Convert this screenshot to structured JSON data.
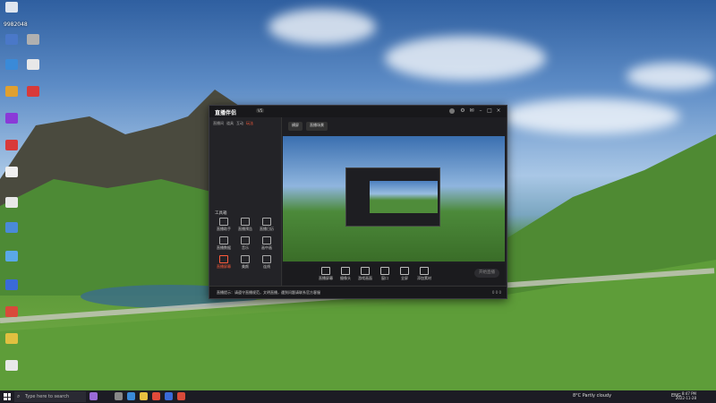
{
  "desktop": {
    "top_number": "9982048",
    "icons": [
      {
        "label": "",
        "color": "#4a78c8"
      },
      {
        "label": "",
        "color": "#3a8ad8"
      },
      {
        "label": "",
        "color": "#e04a3a"
      },
      {
        "label": "",
        "color": "#8a3ad8"
      },
      {
        "label": "",
        "color": "#d83a3a"
      },
      {
        "label": "",
        "color": "#4a8ad8"
      },
      {
        "label": "",
        "color": "#5aa8e8"
      },
      {
        "label": "",
        "color": "#3a6ad8"
      },
      {
        "label": "",
        "color": "#d84a3a"
      },
      {
        "label": "",
        "color": "#a8a8a8"
      }
    ]
  },
  "app": {
    "logo": "直播伴侣",
    "version": "V5",
    "side_tabs": [
      "直播间",
      "道具",
      "互动",
      "玩法"
    ],
    "section_label": "工具箱",
    "tools": [
      {
        "label": "直播助手"
      },
      {
        "label": "直播预告"
      },
      {
        "label": "直播日历"
      },
      {
        "label": "直播数据"
      },
      {
        "label": "音乐"
      },
      {
        "label": "画中画"
      },
      {
        "label": "直播屏幕"
      },
      {
        "label": "美颜"
      },
      {
        "label": "连线"
      },
      {
        "label": ""
      },
      {
        "label": ""
      },
      {
        "label": ""
      }
    ],
    "top_pills": [
      "横屏",
      "直播场景"
    ],
    "controls": [
      "直播屏幕",
      "摄像头",
      "游戏画面",
      "窗口",
      "全屏",
      "添加素材"
    ],
    "live_button": "开始直播",
    "status_text": "直播提示：请遵守直播规范，文明直播，遇到问题请联系官方客服",
    "status_right": "0 0 0"
  },
  "taskbar": {
    "search_placeholder": "Type here to search",
    "weather": "8°C  Partly cloudy",
    "lang": "ENG",
    "time": "8:47 PM",
    "date": "2022-11-28"
  }
}
